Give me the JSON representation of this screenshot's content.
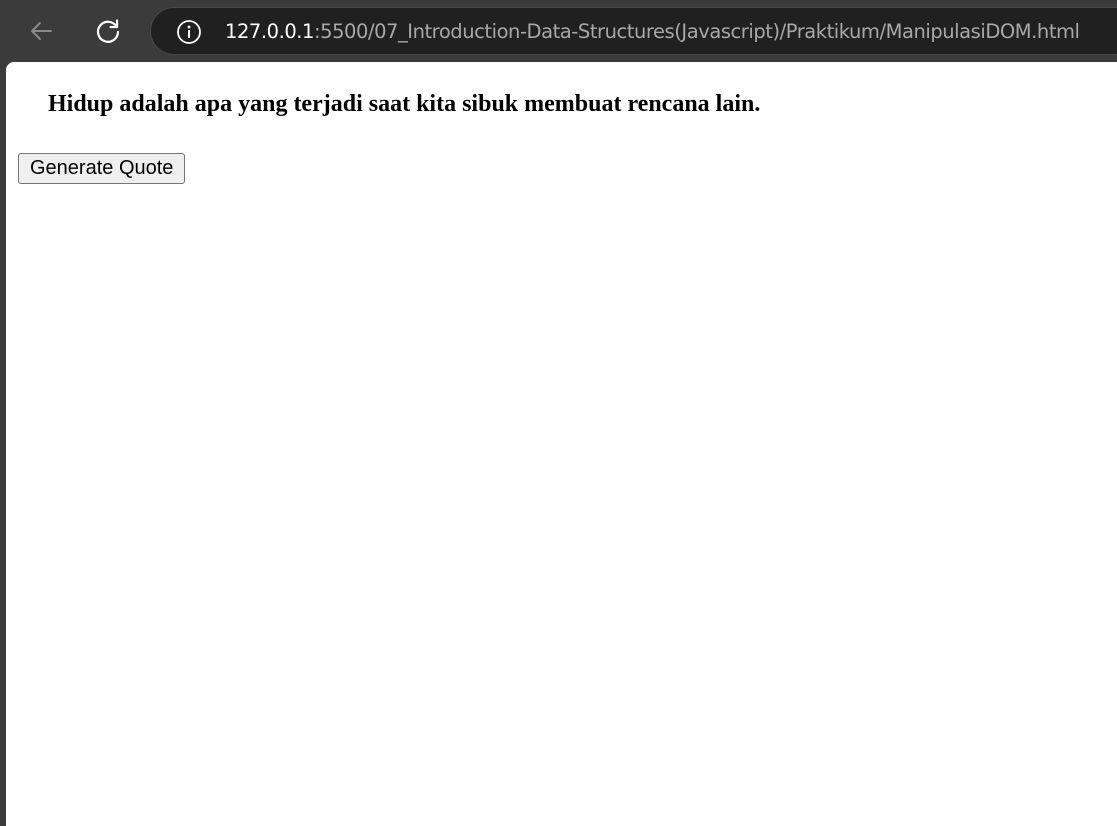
{
  "browser": {
    "url_host": "127.0.0.1",
    "url_path": ":5500/07_Introduction-Data-Structures(Javascript)/Praktikum/ManipulasiDOM.html",
    "icons": {
      "back": "back-arrow-icon",
      "reload": "reload-icon",
      "site_info": "info-icon"
    }
  },
  "page": {
    "quote": "Hidup adalah apa yang terjadi saat kita sibuk membuat rencana lain.",
    "generate_button_label": "Generate Quote"
  },
  "colors": {
    "toolbar_bg": "#3b3b3b",
    "address_bar_bg": "#202020",
    "url_host": "#ffffff",
    "url_path": "#a8a8a8",
    "page_bg": "#ffffff"
  }
}
